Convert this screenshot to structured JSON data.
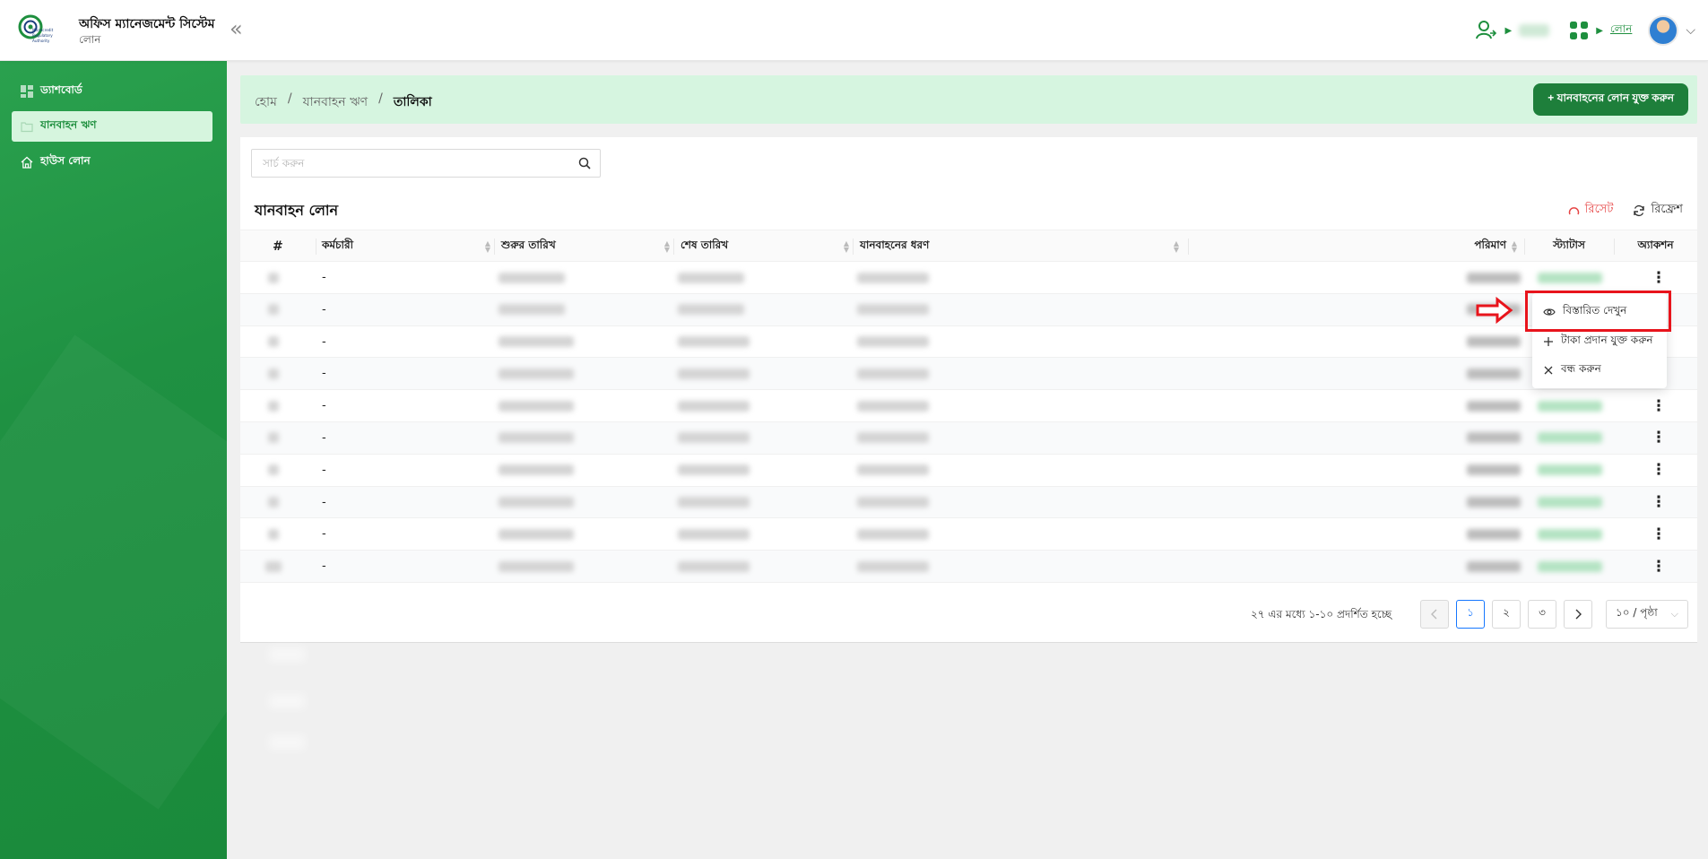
{
  "header": {
    "logo_text": "Microcredit Regulatory Authority",
    "title": "অফিস ম্যানেজমেন্ট সিস্টেম",
    "subtitle": "লোন",
    "collapse_icon": "«",
    "module_link": "লোন"
  },
  "sidebar": {
    "items": [
      {
        "label": "ড্যাশবোর্ড",
        "icon": "dashboard-icon"
      },
      {
        "label": "যানবাহন ঋণ",
        "icon": "folder-icon"
      },
      {
        "label": "হাউস লোন",
        "icon": "home-icon"
      }
    ]
  },
  "breadcrumb": {
    "home": "হোম",
    "section": "যানবাহন ঋণ",
    "current": "তালিকা",
    "separator": "/"
  },
  "add_button": "+ যানবাহনের লোন যুক্ত করুন",
  "search": {
    "placeholder": "সার্চ করুন",
    "value": ""
  },
  "table": {
    "title": "যানবাহন লোন",
    "reset": "রিসেট",
    "refresh": "রিফ্রেশ",
    "columns": {
      "index": "#",
      "employee": "কর্মচারী",
      "start_date": "শুরুর তারিখ",
      "end_date": "শেষ তারিখ",
      "vehicle_type": "যানবাহনের ধরণ",
      "amount": "পরিমাণ",
      "status": "স্ট্যাটাস",
      "action": "অ্যাকশন"
    },
    "rows": [
      {
        "employee": "-"
      },
      {
        "employee": "-"
      },
      {
        "employee": "-"
      },
      {
        "employee": "-"
      },
      {
        "employee": "-"
      },
      {
        "employee": "-"
      },
      {
        "employee": "-"
      },
      {
        "employee": "-"
      },
      {
        "employee": "-"
      },
      {
        "employee": "-"
      }
    ]
  },
  "pagination": {
    "summary": "২৭ এর মধ্যে ১-১০ প্রদর্শিত হচ্ছে",
    "pages": [
      "১",
      "২",
      "৩"
    ],
    "current": "১",
    "page_size": "১০ / পৃষ্ঠা"
  },
  "action_menu": {
    "items": [
      {
        "label": "বিস্তারিত দেখুন",
        "icon": "eye-icon"
      },
      {
        "label": "টাকা প্রদান যুক্ত করুন",
        "icon": "plus-icon"
      },
      {
        "label": "বন্ধ করুন",
        "icon": "close-icon"
      }
    ]
  },
  "colors": {
    "primary": "#1e8f3e",
    "sidebar": "#22984a",
    "breadcrumb_bg": "#d6f5e0",
    "button": "#1e7f3b",
    "highlight": "#e8141c",
    "reset": "#e64545",
    "page_active": "#1677ff"
  }
}
